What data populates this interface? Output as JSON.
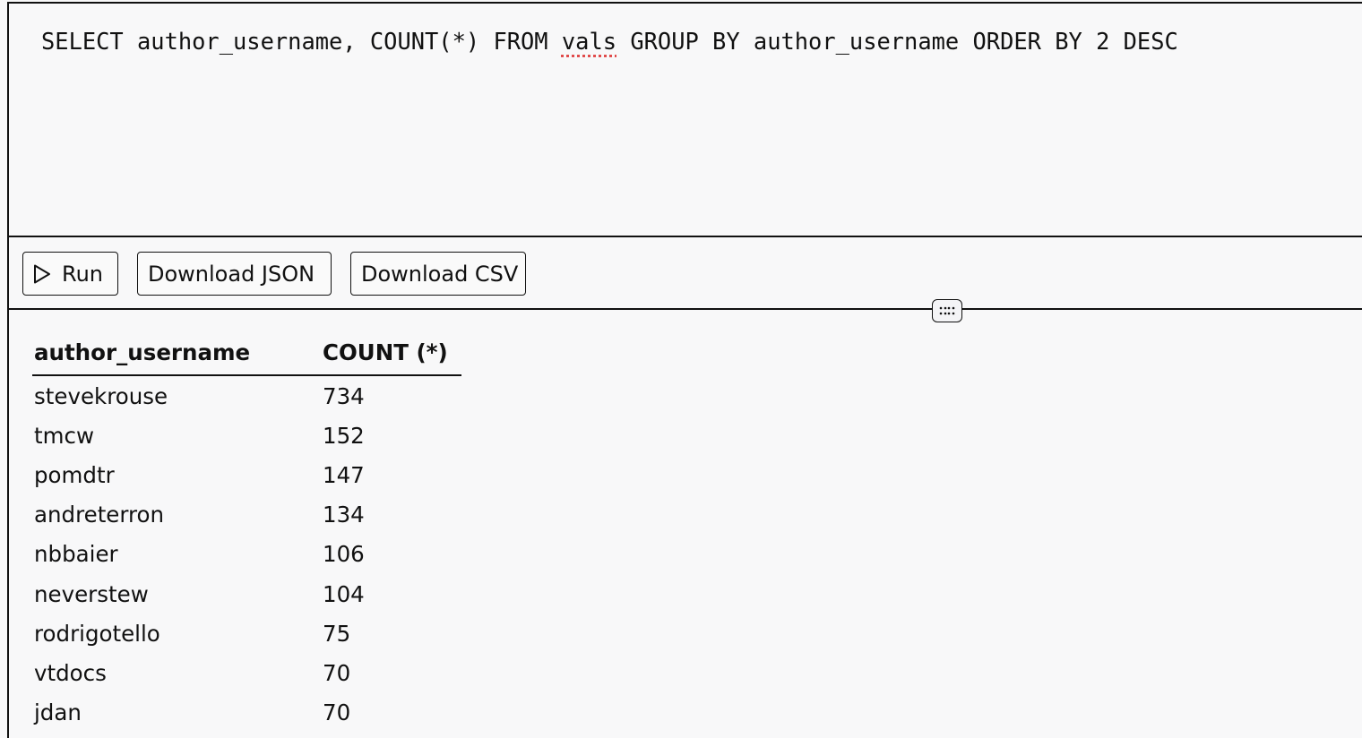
{
  "editor": {
    "query_before": "SELECT author_username, COUNT(*) FROM ",
    "query_flagged": "vals",
    "query_after": " GROUP BY author_username ORDER BY 2 DESC"
  },
  "toolbar": {
    "run_label": "Run",
    "download_json_label": "Download JSON",
    "download_csv_label": "Download CSV"
  },
  "results": {
    "columns": [
      "author_username",
      "COUNT (*)"
    ],
    "rows": [
      [
        "stevekrouse",
        "734"
      ],
      [
        "tmcw",
        "152"
      ],
      [
        "pomdtr",
        "147"
      ],
      [
        "andreterron",
        "134"
      ],
      [
        "nbbaier",
        "106"
      ],
      [
        "neverstew",
        "104"
      ],
      [
        "rodrigotello",
        "75"
      ],
      [
        "vtdocs",
        "70"
      ],
      [
        "jdan",
        "70"
      ]
    ]
  },
  "icons": {
    "run": "play-icon",
    "resize": "drag-handle-icon"
  }
}
